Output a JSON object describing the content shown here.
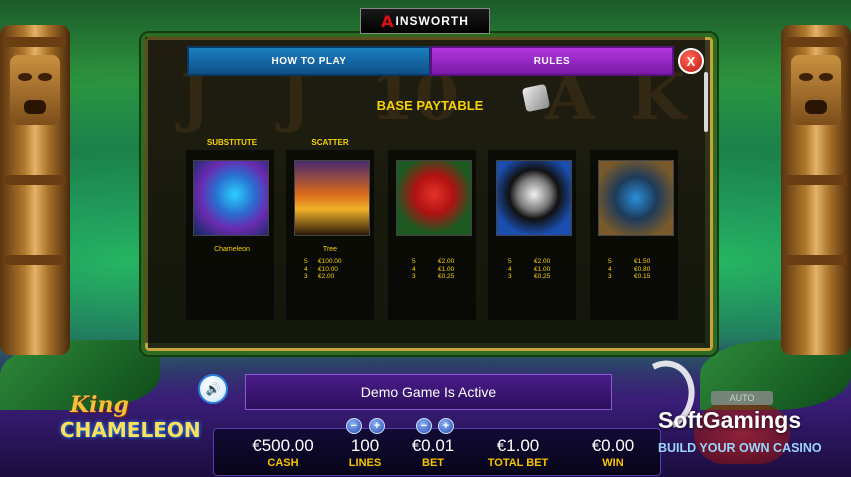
{
  "brand": {
    "logo_letter": "A",
    "name": "INSWORTH"
  },
  "tabs": [
    {
      "label": "HOW TO PLAY",
      "active": false
    },
    {
      "label": "RULES",
      "active": true
    }
  ],
  "close_label": "X",
  "paytable": {
    "title": "BASE PAYTABLE",
    "symbols": [
      {
        "tag": "SUBSTITUTE",
        "name": "Chameleon",
        "pays": []
      },
      {
        "tag": "SCATTER",
        "name": "Tree",
        "pays": [
          {
            "n": "5",
            "v": "€100.00"
          },
          {
            "n": "4",
            "v": "€10.00"
          },
          {
            "n": "3",
            "v": "€2.00"
          }
        ]
      },
      {
        "tag": "",
        "name": "",
        "pays": [
          {
            "n": "5",
            "v": "€2.00"
          },
          {
            "n": "4",
            "v": "€1.00"
          },
          {
            "n": "3",
            "v": "€0.25"
          }
        ]
      },
      {
        "tag": "",
        "name": "",
        "pays": [
          {
            "n": "5",
            "v": "€2.00"
          },
          {
            "n": "4",
            "v": "€1.00"
          },
          {
            "n": "3",
            "v": "€0.25"
          }
        ]
      },
      {
        "tag": "",
        "name": "",
        "pays": [
          {
            "n": "5",
            "v": "€1.50"
          },
          {
            "n": "4",
            "v": "€0.80"
          },
          {
            "n": "3",
            "v": "€0.15"
          }
        ]
      }
    ]
  },
  "reel_letters": [
    "J",
    "J",
    "10",
    "A",
    "K"
  ],
  "game_logo": {
    "line1": "King",
    "line2": "CHAMELEON"
  },
  "message": "Demo Game Is Active",
  "meters": {
    "cash": {
      "value": "€500.00",
      "label": "CASH"
    },
    "lines": {
      "value": "100",
      "label": "LINES"
    },
    "bet": {
      "value": "€0.01",
      "label": "BET"
    },
    "total_bet": {
      "value": "€1.00",
      "label": "TOTAL BET"
    },
    "win": {
      "value": "€0.00",
      "label": "WIN"
    }
  },
  "controls": {
    "minus": "−",
    "plus": "+",
    "auto": "AUTO"
  },
  "watermark": {
    "name": "SoftGamings",
    "tagline": "BUILD YOUR OWN CASINO"
  }
}
